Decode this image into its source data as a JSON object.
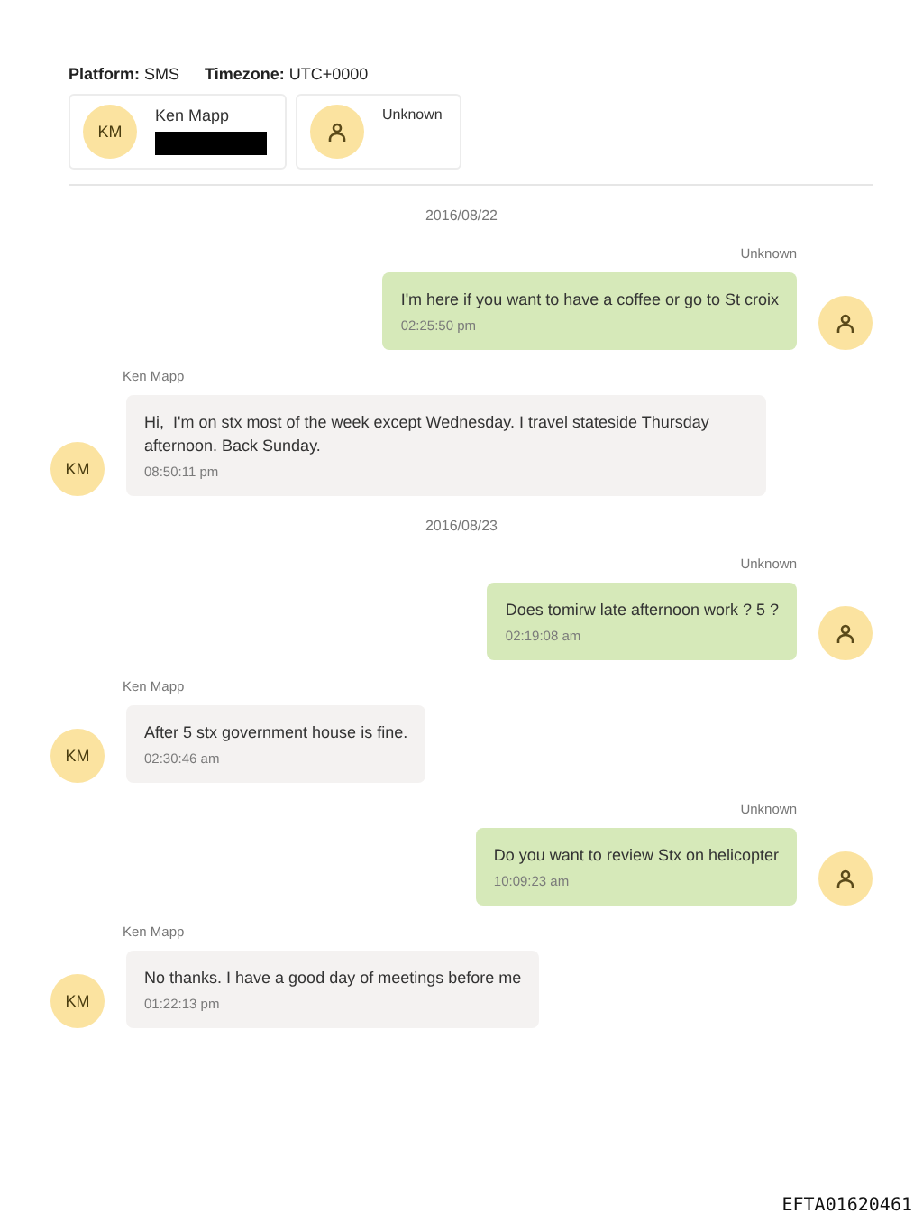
{
  "header": {
    "platform": "**Platform:** SMS",
    "timezone": "**Timezone:** UTC+0000"
  },
  "participants": [
    {
      "avatar": {
        "kind": "initials",
        "initials": "KM"
      },
      "name": "Ken Mapp",
      "redacted": true
    },
    {
      "avatar": {
        "kind": "person"
      },
      "name": "Unknown",
      "redacted": false
    }
  ],
  "conversation": [
    {
      "kind": "date",
      "text": "2016/08/22"
    },
    {
      "kind": "message",
      "outgoing": true,
      "sender": "Unknown",
      "avatar": {
        "kind": "person"
      },
      "text": "I'm here if you want to have a coffee or go to St croix",
      "time": "02:25:50 pm"
    },
    {
      "kind": "message",
      "outgoing": false,
      "sender": "Ken Mapp",
      "avatar": {
        "kind": "initials",
        "initials": "KM"
      },
      "text": "Hi,  I'm on stx most of the week except Wednesday. I travel stateside Thursday afternoon. Back Sunday.",
      "time": "08:50:11 pm"
    },
    {
      "kind": "date",
      "text": "2016/08/23"
    },
    {
      "kind": "message",
      "outgoing": true,
      "sender": "Unknown",
      "avatar": {
        "kind": "person"
      },
      "text": "Does tomirw late afternoon work ? 5 ?",
      "time": "02:19:08 am"
    },
    {
      "kind": "message",
      "outgoing": false,
      "sender": "Ken Mapp",
      "avatar": {
        "kind": "initials",
        "initials": "KM"
      },
      "text": "After 5 stx government house is fine.",
      "time": "02:30:46 am"
    },
    {
      "kind": "message",
      "outgoing": true,
      "sender": "Unknown",
      "avatar": {
        "kind": "person"
      },
      "text": "Do you want to review Stx on helicopter",
      "time": "10:09:23 am"
    },
    {
      "kind": "message",
      "outgoing": false,
      "sender": "Ken Mapp",
      "avatar": {
        "kind": "initials",
        "initials": "KM"
      },
      "text": "No thanks. I have a good day of meetings before me",
      "time": "01:22:13 pm"
    }
  ],
  "footer": {
    "document_id": "EFTA01620461"
  }
}
